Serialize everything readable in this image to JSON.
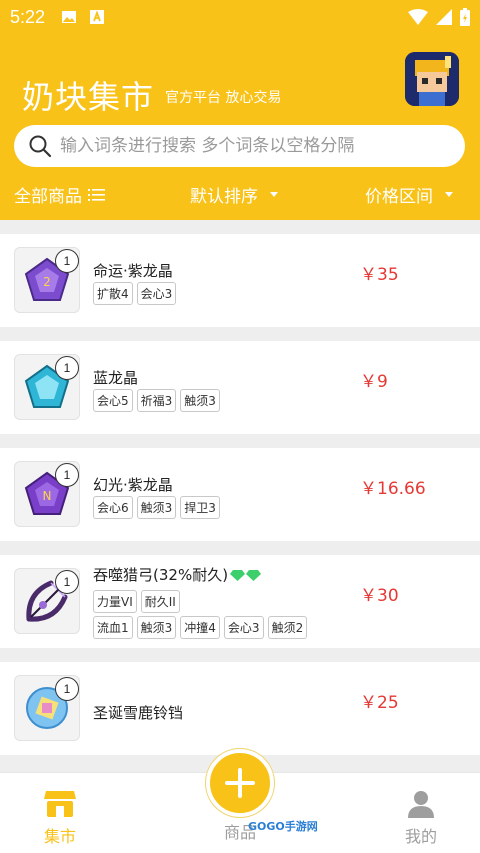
{
  "status": {
    "time": "5:22"
  },
  "header": {
    "title": "奶块集市",
    "subtitle": "官方平台 放心交易"
  },
  "search": {
    "placeholder": "输入词条进行搜索 多个词条以空格分隔"
  },
  "filters": {
    "all_goods": "全部商品",
    "default_sort": "默认排序",
    "price_range": "价格区间"
  },
  "items": [
    {
      "qty": "1",
      "name": "命运·紫龙晶",
      "tags": [
        "扩散4",
        "会心3"
      ],
      "price": "￥35",
      "gem_color": "#7c4ccf"
    },
    {
      "qty": "1",
      "name": "蓝龙晶",
      "tags": [
        "会心5",
        "祈福3",
        "触须3"
      ],
      "price": "￥9",
      "gem_color": "#2fb6d6"
    },
    {
      "qty": "1",
      "name": "幻光·紫龙晶",
      "tags": [
        "会心6",
        "触须3",
        "捍卫3"
      ],
      "price": "￥16.66",
      "gem_color": "#7a3fc8"
    },
    {
      "qty": "1",
      "name": "吞噬猎弓(32%耐久)",
      "tags": [
        "力量VI",
        "耐久II"
      ],
      "tags2": [
        "流血1",
        "触须3",
        "冲撞4",
        "会心3",
        "触须2"
      ],
      "price": "￥30",
      "gem_color": "#4a2b6a"
    },
    {
      "qty": "1",
      "name": "圣诞雪鹿铃铛",
      "tags": [],
      "price": "￥25",
      "gem_color": "#7fc3f0"
    }
  ],
  "nav": {
    "market": "集市",
    "goods": "商品",
    "mine": "我的",
    "watermark": "GOGO手游网"
  },
  "colors": {
    "brand": "#f8c219",
    "price": "#e53935",
    "inactive": "#9e9e9e"
  }
}
